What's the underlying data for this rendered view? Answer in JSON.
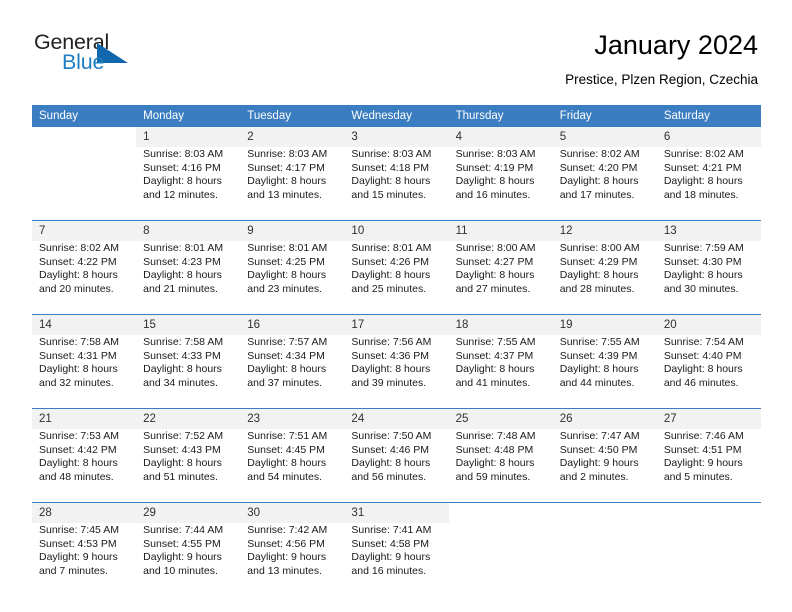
{
  "brand": {
    "name_dark": "General",
    "name_blue": "Blue",
    "triangle_color": "#1067ad",
    "blue_color": "#1d7ec4"
  },
  "header": {
    "title": "January 2024",
    "subtitle": "Prestice, Plzen Region, Czechia",
    "header_bg": "#3a7dc0",
    "daynum_bg": "#f2f2f2"
  },
  "weekday_headers": [
    "Sunday",
    "Monday",
    "Tuesday",
    "Wednesday",
    "Thursday",
    "Friday",
    "Saturday"
  ],
  "weeks": [
    [
      {
        "day": "",
        "sunrise": "",
        "sunset": "",
        "daylight_1": "",
        "daylight_2": ""
      },
      {
        "day": "1",
        "sunrise": "Sunrise: 8:03 AM",
        "sunset": "Sunset: 4:16 PM",
        "daylight_1": "Daylight: 8 hours",
        "daylight_2": "and 12 minutes."
      },
      {
        "day": "2",
        "sunrise": "Sunrise: 8:03 AM",
        "sunset": "Sunset: 4:17 PM",
        "daylight_1": "Daylight: 8 hours",
        "daylight_2": "and 13 minutes."
      },
      {
        "day": "3",
        "sunrise": "Sunrise: 8:03 AM",
        "sunset": "Sunset: 4:18 PM",
        "daylight_1": "Daylight: 8 hours",
        "daylight_2": "and 15 minutes."
      },
      {
        "day": "4",
        "sunrise": "Sunrise: 8:03 AM",
        "sunset": "Sunset: 4:19 PM",
        "daylight_1": "Daylight: 8 hours",
        "daylight_2": "and 16 minutes."
      },
      {
        "day": "5",
        "sunrise": "Sunrise: 8:02 AM",
        "sunset": "Sunset: 4:20 PM",
        "daylight_1": "Daylight: 8 hours",
        "daylight_2": "and 17 minutes."
      },
      {
        "day": "6",
        "sunrise": "Sunrise: 8:02 AM",
        "sunset": "Sunset: 4:21 PM",
        "daylight_1": "Daylight: 8 hours",
        "daylight_2": "and 18 minutes."
      }
    ],
    [
      {
        "day": "7",
        "sunrise": "Sunrise: 8:02 AM",
        "sunset": "Sunset: 4:22 PM",
        "daylight_1": "Daylight: 8 hours",
        "daylight_2": "and 20 minutes."
      },
      {
        "day": "8",
        "sunrise": "Sunrise: 8:01 AM",
        "sunset": "Sunset: 4:23 PM",
        "daylight_1": "Daylight: 8 hours",
        "daylight_2": "and 21 minutes."
      },
      {
        "day": "9",
        "sunrise": "Sunrise: 8:01 AM",
        "sunset": "Sunset: 4:25 PM",
        "daylight_1": "Daylight: 8 hours",
        "daylight_2": "and 23 minutes."
      },
      {
        "day": "10",
        "sunrise": "Sunrise: 8:01 AM",
        "sunset": "Sunset: 4:26 PM",
        "daylight_1": "Daylight: 8 hours",
        "daylight_2": "and 25 minutes."
      },
      {
        "day": "11",
        "sunrise": "Sunrise: 8:00 AM",
        "sunset": "Sunset: 4:27 PM",
        "daylight_1": "Daylight: 8 hours",
        "daylight_2": "and 27 minutes."
      },
      {
        "day": "12",
        "sunrise": "Sunrise: 8:00 AM",
        "sunset": "Sunset: 4:29 PM",
        "daylight_1": "Daylight: 8 hours",
        "daylight_2": "and 28 minutes."
      },
      {
        "day": "13",
        "sunrise": "Sunrise: 7:59 AM",
        "sunset": "Sunset: 4:30 PM",
        "daylight_1": "Daylight: 8 hours",
        "daylight_2": "and 30 minutes."
      }
    ],
    [
      {
        "day": "14",
        "sunrise": "Sunrise: 7:58 AM",
        "sunset": "Sunset: 4:31 PM",
        "daylight_1": "Daylight: 8 hours",
        "daylight_2": "and 32 minutes."
      },
      {
        "day": "15",
        "sunrise": "Sunrise: 7:58 AM",
        "sunset": "Sunset: 4:33 PM",
        "daylight_1": "Daylight: 8 hours",
        "daylight_2": "and 34 minutes."
      },
      {
        "day": "16",
        "sunrise": "Sunrise: 7:57 AM",
        "sunset": "Sunset: 4:34 PM",
        "daylight_1": "Daylight: 8 hours",
        "daylight_2": "and 37 minutes."
      },
      {
        "day": "17",
        "sunrise": "Sunrise: 7:56 AM",
        "sunset": "Sunset: 4:36 PM",
        "daylight_1": "Daylight: 8 hours",
        "daylight_2": "and 39 minutes."
      },
      {
        "day": "18",
        "sunrise": "Sunrise: 7:55 AM",
        "sunset": "Sunset: 4:37 PM",
        "daylight_1": "Daylight: 8 hours",
        "daylight_2": "and 41 minutes."
      },
      {
        "day": "19",
        "sunrise": "Sunrise: 7:55 AM",
        "sunset": "Sunset: 4:39 PM",
        "daylight_1": "Daylight: 8 hours",
        "daylight_2": "and 44 minutes."
      },
      {
        "day": "20",
        "sunrise": "Sunrise: 7:54 AM",
        "sunset": "Sunset: 4:40 PM",
        "daylight_1": "Daylight: 8 hours",
        "daylight_2": "and 46 minutes."
      }
    ],
    [
      {
        "day": "21",
        "sunrise": "Sunrise: 7:53 AM",
        "sunset": "Sunset: 4:42 PM",
        "daylight_1": "Daylight: 8 hours",
        "daylight_2": "and 48 minutes."
      },
      {
        "day": "22",
        "sunrise": "Sunrise: 7:52 AM",
        "sunset": "Sunset: 4:43 PM",
        "daylight_1": "Daylight: 8 hours",
        "daylight_2": "and 51 minutes."
      },
      {
        "day": "23",
        "sunrise": "Sunrise: 7:51 AM",
        "sunset": "Sunset: 4:45 PM",
        "daylight_1": "Daylight: 8 hours",
        "daylight_2": "and 54 minutes."
      },
      {
        "day": "24",
        "sunrise": "Sunrise: 7:50 AM",
        "sunset": "Sunset: 4:46 PM",
        "daylight_1": "Daylight: 8 hours",
        "daylight_2": "and 56 minutes."
      },
      {
        "day": "25",
        "sunrise": "Sunrise: 7:48 AM",
        "sunset": "Sunset: 4:48 PM",
        "daylight_1": "Daylight: 8 hours",
        "daylight_2": "and 59 minutes."
      },
      {
        "day": "26",
        "sunrise": "Sunrise: 7:47 AM",
        "sunset": "Sunset: 4:50 PM",
        "daylight_1": "Daylight: 9 hours",
        "daylight_2": "and 2 minutes."
      },
      {
        "day": "27",
        "sunrise": "Sunrise: 7:46 AM",
        "sunset": "Sunset: 4:51 PM",
        "daylight_1": "Daylight: 9 hours",
        "daylight_2": "and 5 minutes."
      }
    ],
    [
      {
        "day": "28",
        "sunrise": "Sunrise: 7:45 AM",
        "sunset": "Sunset: 4:53 PM",
        "daylight_1": "Daylight: 9 hours",
        "daylight_2": "and 7 minutes."
      },
      {
        "day": "29",
        "sunrise": "Sunrise: 7:44 AM",
        "sunset": "Sunset: 4:55 PM",
        "daylight_1": "Daylight: 9 hours",
        "daylight_2": "and 10 minutes."
      },
      {
        "day": "30",
        "sunrise": "Sunrise: 7:42 AM",
        "sunset": "Sunset: 4:56 PM",
        "daylight_1": "Daylight: 9 hours",
        "daylight_2": "and 13 minutes."
      },
      {
        "day": "31",
        "sunrise": "Sunrise: 7:41 AM",
        "sunset": "Sunset: 4:58 PM",
        "daylight_1": "Daylight: 9 hours",
        "daylight_2": "and 16 minutes."
      },
      {
        "day": "",
        "sunrise": "",
        "sunset": "",
        "daylight_1": "",
        "daylight_2": ""
      },
      {
        "day": "",
        "sunrise": "",
        "sunset": "",
        "daylight_1": "",
        "daylight_2": ""
      },
      {
        "day": "",
        "sunrise": "",
        "sunset": "",
        "daylight_1": "",
        "daylight_2": ""
      }
    ]
  ]
}
